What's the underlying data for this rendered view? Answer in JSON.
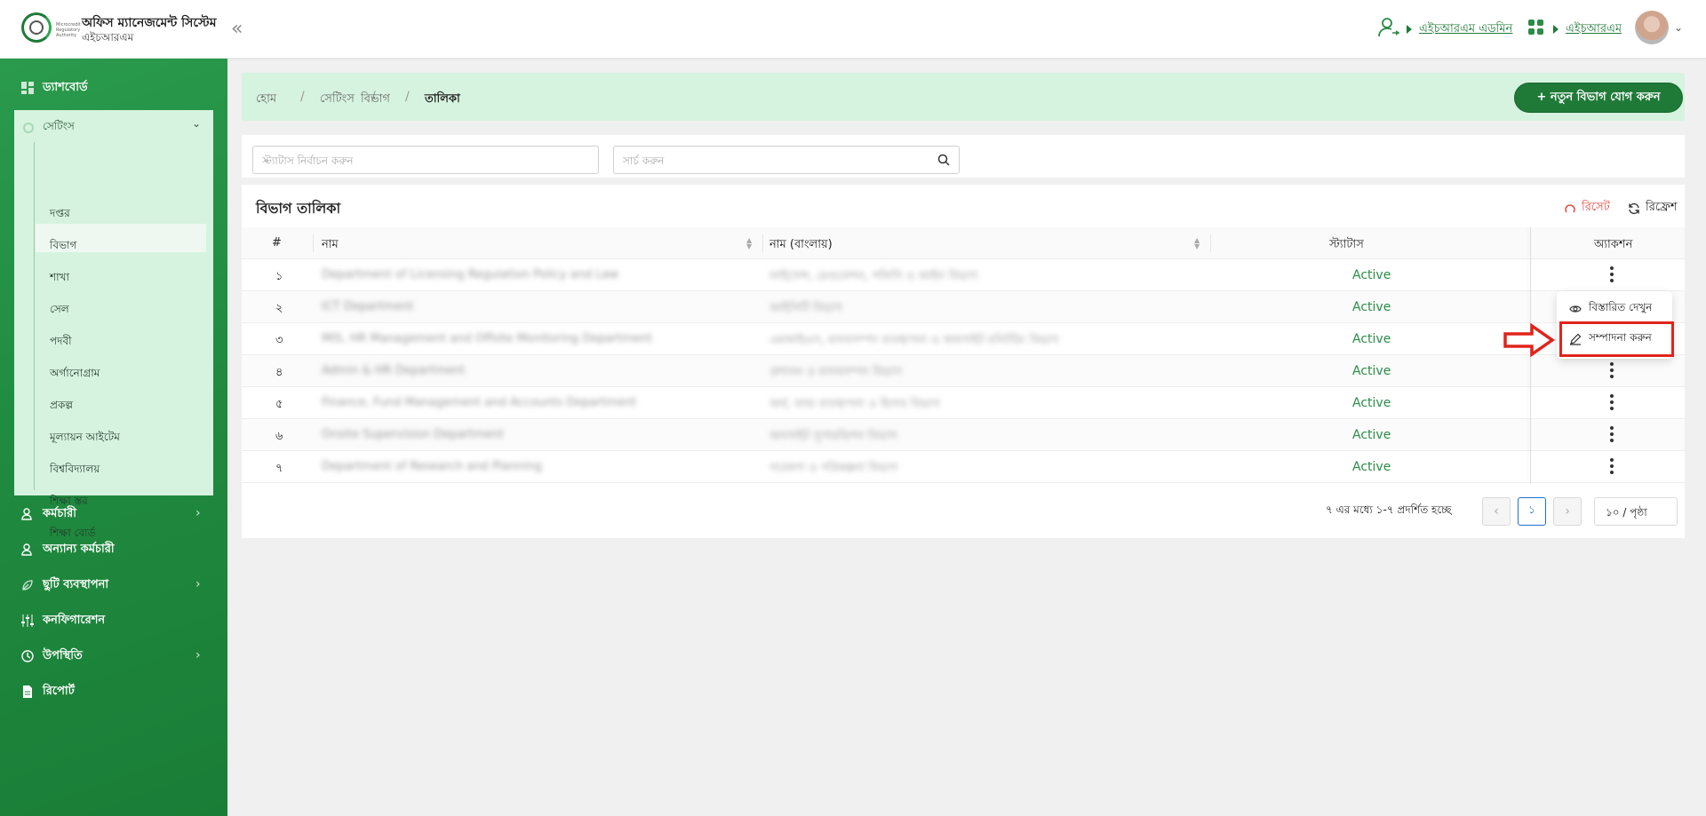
{
  "header": {
    "app_title": "অফিস ম্যানেজমেন্ট সিস্টেম",
    "app_subtitle": "এইচআরএম",
    "user_link": "এইচআরএম এডমিন",
    "module_link": "এইচআরএম",
    "logo_text": "Microcredit Regulatory Authority"
  },
  "sidebar": {
    "dashboard": "ড্যাশবোর্ড",
    "settings": "সেটিংস",
    "settings_items": [
      "দপ্তর",
      "বিভাগ",
      "শাখা",
      "সেল",
      "পদবী",
      "অর্গানোগ্রাম",
      "প্রকল্প",
      "মূল্যায়ন আইটেম",
      "বিশ্ববিদ্যালয়",
      "শিক্ষা স্তর",
      "শিক্ষা বোর্ড"
    ],
    "active_item": "বিভাগ",
    "employee": "কর্মচারী",
    "other_employee": "অন্যান্য কর্মচারী",
    "leave_management": "ছুটি ব্যবস্থাপনা",
    "configuration": "কনফিগারেশন",
    "attendance": "উপস্থিতি",
    "report": "রিপোর্ট"
  },
  "breadcrumb": [
    "হোম",
    "সেটিংস",
    "বিভাগ",
    "তালিকা"
  ],
  "add_button": "+ নতুন বিভাগ যোগ করুন",
  "filters": {
    "status_placeholder": "স্ট্যাটাস নির্বাচন করুন",
    "search_placeholder": "সার্চ করুন"
  },
  "table": {
    "title": "বিভাগ তালিকা",
    "reset": "রিসেট",
    "refresh": "রিফ্রেশ",
    "columns": [
      "#",
      "নাম",
      "নাম (বাংলায়)",
      "স্ট্যাটাস",
      "অ্যাকশন"
    ],
    "rows": [
      {
        "num": "১",
        "name": "Department of Licensing Regulation Policy and Law",
        "name_bn": "লাইসেন্স, রেগুলেশন, পলিসি ও আইন বিভাগ",
        "status": "Active"
      },
      {
        "num": "২",
        "name": "ICT Department",
        "name_bn": "আইসিটি বিভাগ",
        "status": "Active"
      },
      {
        "num": "৩",
        "name": "MIS, HR Management and Offsite Monitoring Department",
        "name_bn": "এমআইএস, মানবসম্পদ ব্যবস্থাপনা ও অফসাইট মনিটরিং বিভাগ",
        "status": "Active"
      },
      {
        "num": "৪",
        "name": "Admin & HR Department",
        "name_bn": "প্রশাসন ও মানবসম্পদ বিভাগ",
        "status": "Active"
      },
      {
        "num": "৫",
        "name": "Finance, Fund Management and Accounts Department",
        "name_bn": "অর্থ, ফান্ড ব্যবস্থাপনা ও হিসাব বিভাগ",
        "status": "Active"
      },
      {
        "num": "৬",
        "name": "Onsite Supervision Department",
        "name_bn": "অনসাইট সুপারভিশন বিভাগ",
        "status": "Active"
      },
      {
        "num": "৭",
        "name": "Department of Research and Planning",
        "name_bn": "গবেষণা ও পরিকল্পনা বিভাগ",
        "status": "Active"
      }
    ]
  },
  "action_menu": {
    "view": "বিস্তারিত দেখুন",
    "edit": "সম্পাদনা করুন"
  },
  "pagination": {
    "summary": "৭ এর মধ্যে ১-৭ প্রদর্শিত হচ্ছে",
    "current_page": "১",
    "page_size": "১০ / পৃষ্ঠা"
  },
  "colors": {
    "brand_green": "#1f7a38",
    "sidebar_green": "#2a9a4c",
    "breadcrumb_bg": "#d6f3df",
    "status_green": "#2a8c46",
    "highlight_red": "#e0241c"
  }
}
